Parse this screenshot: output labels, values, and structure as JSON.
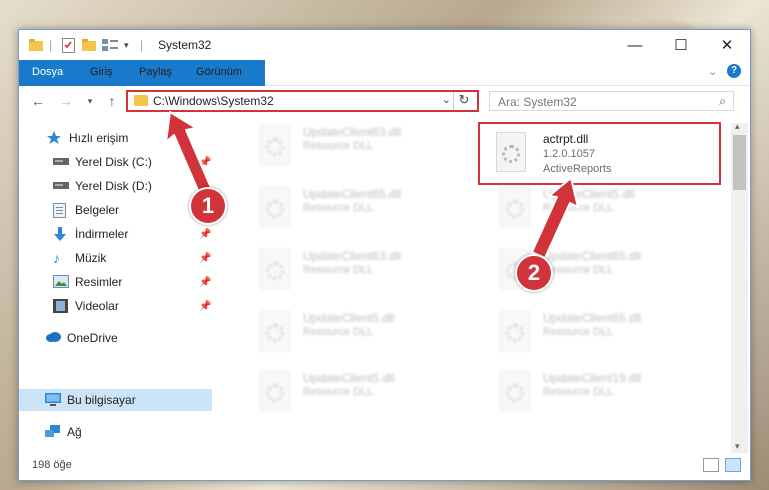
{
  "window": {
    "title": "System32"
  },
  "ribbon": {
    "tabs": [
      "Dosya",
      "Giriş",
      "Paylaş",
      "Görünüm"
    ]
  },
  "address": {
    "path": "C:\\Windows\\System32"
  },
  "search": {
    "placeholder": "Ara: System32"
  },
  "sidebar": {
    "items": [
      {
        "label": "Hızlı erişim",
        "icon": "star-icon"
      },
      {
        "label": "Yerel Disk (C:)",
        "icon": "drive-icon"
      },
      {
        "label": "Yerel Disk (D:)",
        "icon": "drive-icon"
      },
      {
        "label": "Belgeler",
        "icon": "documents-icon"
      },
      {
        "label": "İndirmeler",
        "icon": "download-icon"
      },
      {
        "label": "Müzik",
        "icon": "music-icon"
      },
      {
        "label": "Resimler",
        "icon": "pictures-icon"
      },
      {
        "label": "Videolar",
        "icon": "video-icon"
      },
      {
        "label": "OneDrive",
        "icon": "cloud-icon"
      },
      {
        "label": "Bu bilgisayar",
        "icon": "computer-icon"
      },
      {
        "label": "Ağ",
        "icon": "network-icon"
      }
    ]
  },
  "files": {
    "highlight": {
      "name": "actrpt.dll",
      "version": "1.2.0.1057",
      "company": "ActiveReports"
    },
    "left": [
      {
        "name": "UpdateClient63.dll",
        "desc": "Resource DLL"
      },
      {
        "name": "UpdateClient65.dll",
        "desc": "Resource DLL"
      },
      {
        "name": "UpdateClient63.dll",
        "desc": "Resource DLL"
      },
      {
        "name": "UpdateClient5.dll",
        "desc": "Resource DLL"
      },
      {
        "name": "UpdateClient5.dll",
        "desc": "Resource DLL"
      }
    ],
    "right": [
      {
        "name": "UpdateClient5.dll",
        "desc": "Resource DLL"
      },
      {
        "name": "UpdateClient65.dll",
        "desc": "Resource DLL"
      },
      {
        "name": "UpdateClient65.dll",
        "desc": "Resource DLL"
      },
      {
        "name": "UpdateClient19.dll",
        "desc": "Resource DLL"
      }
    ]
  },
  "status": {
    "count": "198 öğe"
  },
  "annotations": {
    "step1": "1",
    "step2": "2",
    "color": "#d0343a"
  }
}
